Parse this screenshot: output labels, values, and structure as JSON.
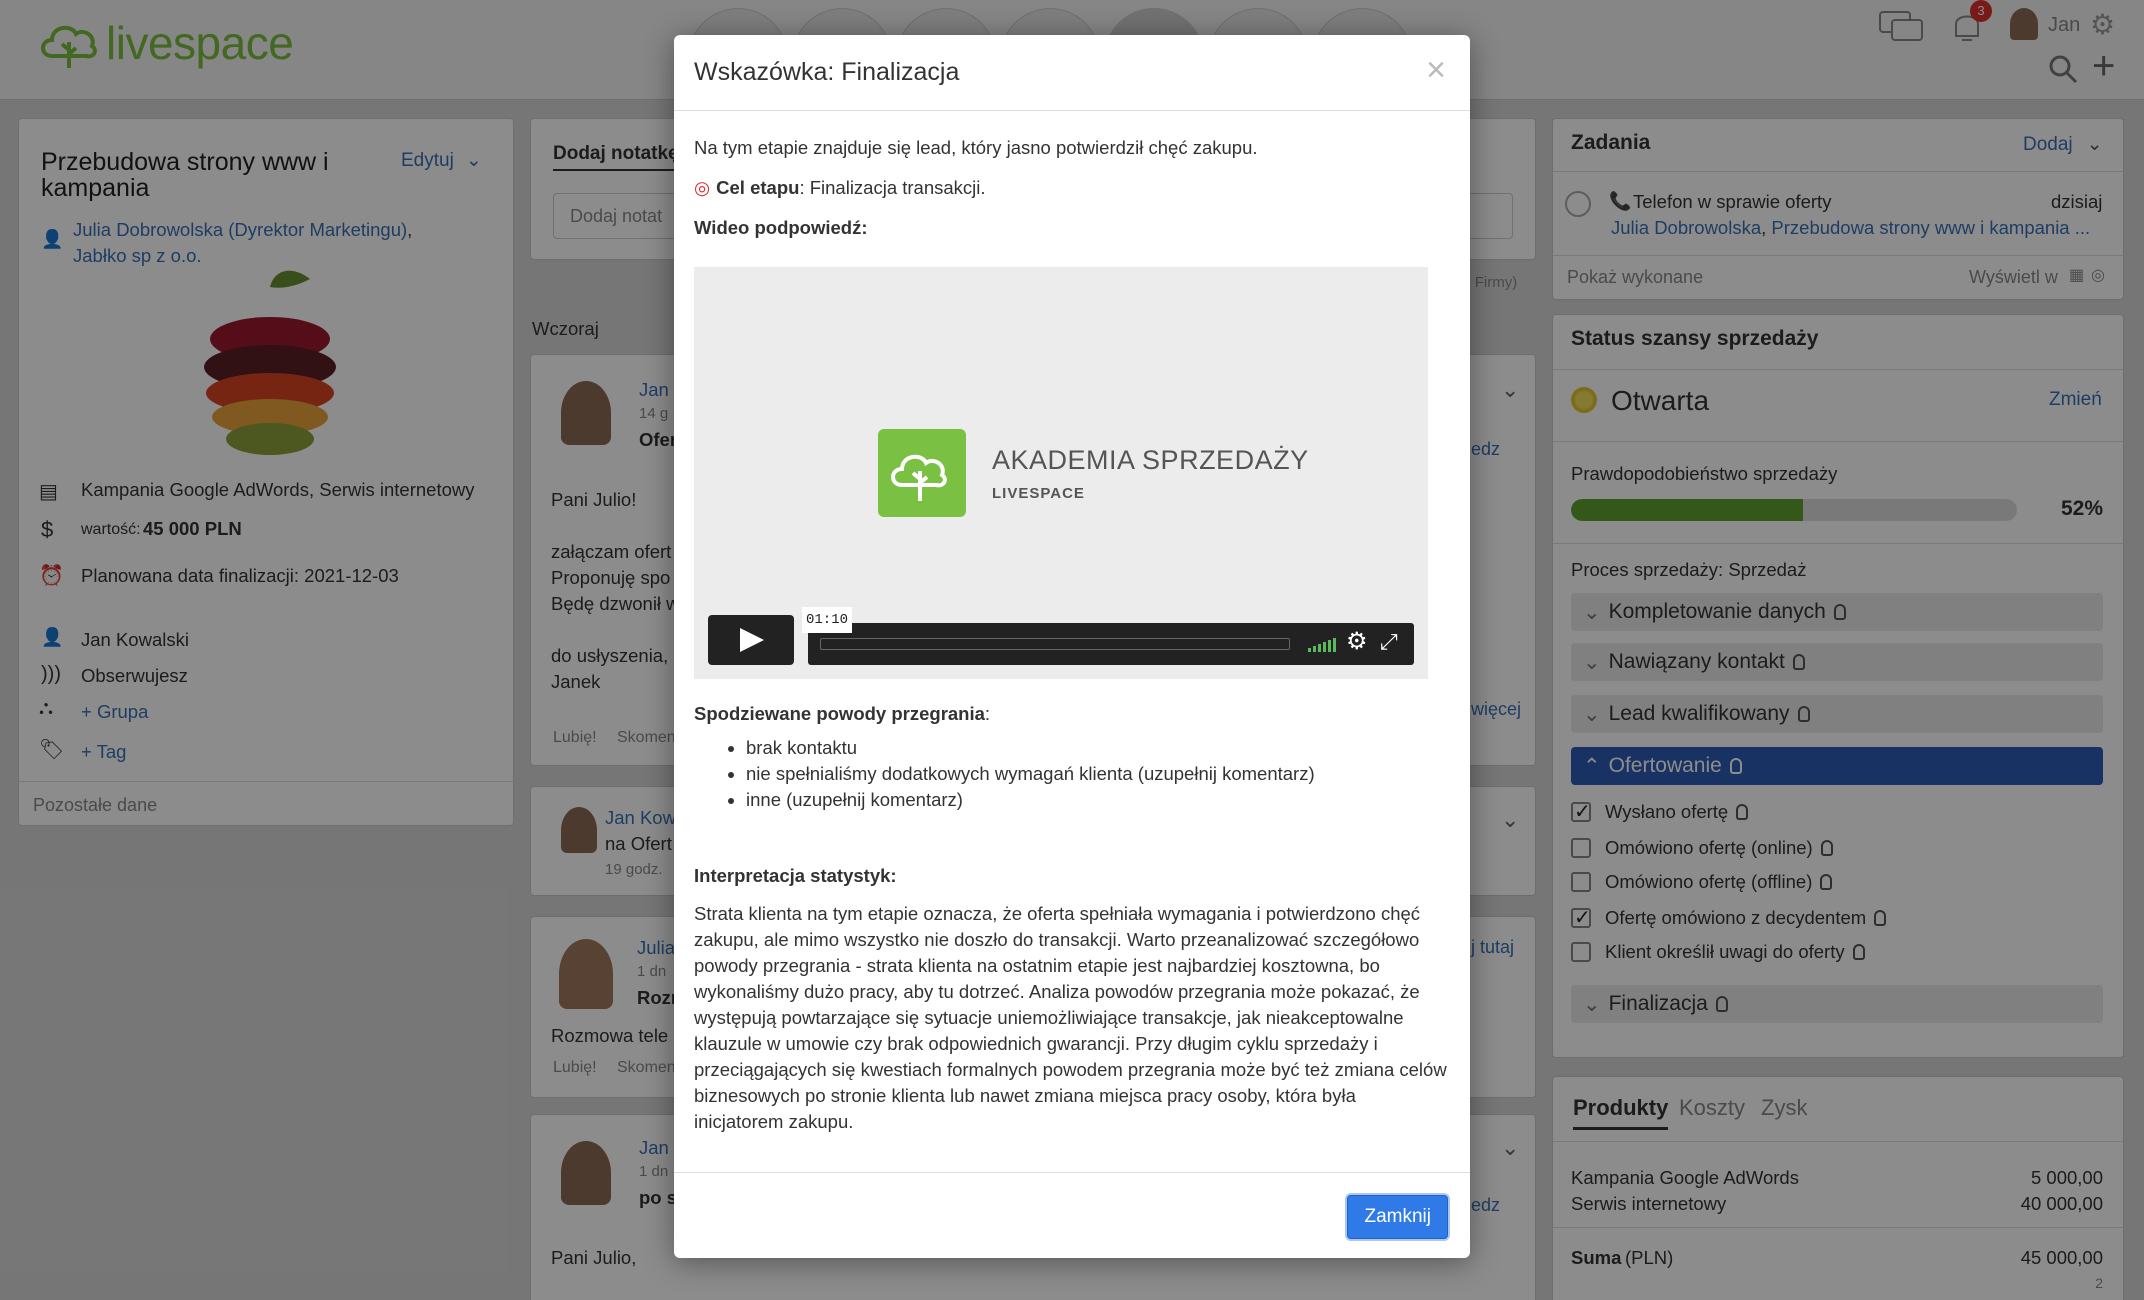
{
  "app": {
    "logo_text": "livespace",
    "user_name": "Jan",
    "notifications_count": "3"
  },
  "deal": {
    "title": "Przebudowa strony www i kampania",
    "edit_label": "Edytuj",
    "contact_link": "Julia Dobrowolska (Dyrektor Marketingu)",
    "company_link": "Jabłko sp z o.o.",
    "products": "Kampania Google AdWords, Serwis internetowy",
    "value_label": "wartość:",
    "value": "45 000 PLN",
    "close_date": "Planowana data finalizacji: 2021-12-03",
    "owner": "Jan Kowalski",
    "follow": "Obserwujesz",
    "group_link": "+ Grupa",
    "tag_link": "+ Tag",
    "other_data": "Pozostałe dane"
  },
  "feed": {
    "tab_add_note": "Dodaj notatkę",
    "note_placeholder": "Dodaj notat",
    "hint": "y, Firmy)",
    "yesterday": "Wczoraj",
    "entry1": {
      "author": "Jan",
      "time": "14 g",
      "subject": "Ofer",
      "body1": "Pani Julio!",
      "body2": "załączam ofert",
      "body3": "Proponuję spo",
      "body4": "Będę dzwonił w",
      "body5": "do usłyszenia,",
      "body6": "Janek",
      "like": "Lubię!",
      "comment": "Skomen",
      "side": "edz",
      "more": "więcej"
    },
    "entry2": {
      "author": "Jan Kow",
      "line": "na Ofert",
      "time": "19 godz."
    },
    "entry3": {
      "author": "Julia",
      "time": "1 dn",
      "subject": "Rozm",
      "body": "Rozmowa tele",
      "like": "Lubię!",
      "comment": "Skomen",
      "side": "j tutaj"
    },
    "entry4": {
      "author": "Jan",
      "time": "1 dn",
      "subject": "po s",
      "body": "Pani Julio,",
      "side": "edz"
    }
  },
  "tasks": {
    "title": "Zadania",
    "add_label": "Dodaj",
    "task_title": "Telefon w sprawie oferty",
    "task_date": "dzisiaj",
    "task_contact": "Julia Dobrowolska",
    "task_deal": "Przebudowa strony www i kampania ...",
    "show_done": "Pokaż wykonane",
    "display_in": "Wyświetl w"
  },
  "status": {
    "title": "Status szansy sprzedaży",
    "state": "Otwarta",
    "change_label": "Zmień",
    "probability_label": "Prawdopodobieństwo sprzedaży",
    "probability": "52%",
    "probability_value": 52,
    "process_label": "Proces sprzedaży: Sprzedaż",
    "stages": [
      "Kompletowanie danych",
      "Nawiązany kontakt",
      "Lead kwalifikowany",
      "Ofertowanie",
      "Finalizacja"
    ],
    "tasks": [
      {
        "label": "Wysłano ofertę",
        "checked": true
      },
      {
        "label": "Omówiono ofertę (online)",
        "checked": false
      },
      {
        "label": "Omówiono ofertę (offline)",
        "checked": false
      },
      {
        "label": "Ofertę omówiono z decydentem",
        "checked": true
      },
      {
        "label": "Klient określił uwagi do oferty",
        "checked": false
      }
    ]
  },
  "products": {
    "tabs": [
      "Produkty",
      "Koszty",
      "Zysk"
    ],
    "items": [
      {
        "name": "Kampania Google AdWords",
        "price": "5 000,00"
      },
      {
        "name": "Serwis internetowy",
        "price": "40 000,00"
      }
    ],
    "sum_label": "Suma",
    "sum_currency": "(PLN)",
    "sum_value": "45 000,00",
    "page": "2"
  },
  "modal": {
    "title": "Wskazówka: Finalizacja",
    "close_symbol": "×",
    "intro": "Na tym etapie znajduje się lead, który jasno potwierdził chęć zakupu.",
    "goal_label": "Cel etapu",
    "goal_text": ": Finalizacja transakcji.",
    "video_label": "Wideo podpowiedź:",
    "video_brand": "AKADEMIA SPRZEDAŻY",
    "video_brand_sub": "LIVESPACE",
    "video_time": "01:10",
    "reasons_label": "Spodziewane powody przegrania",
    "reasons": [
      "brak kontaktu",
      "nie spełnialiśmy dodatkowych wymagań klienta (uzupełnij komentarz)",
      "inne (uzupełnij komentarz)"
    ],
    "stats_label": "Interpretacja statystyk:",
    "stats_text": "Strata klienta na tym etapie oznacza, że oferta spełniała wymagania i potwierdzono chęć zakupu, ale mimo wszystko nie doszło do transakcji. Warto przeanalizować szczegółowo powody przegrania - strata klienta na ostatnim etapie jest najbardziej kosztowna, bo wykonaliśmy dużo pracy, aby tu dotrzeć. Analiza powodów przegrania może pokazać, że występują powtarzające się sytuacje uniemożliwiające transakcje, jak nieakceptowalne klauzule w umowie czy brak odpowiednich gwarancji. Przy długim cyklu sprzedaży i przeciągających się kwestiach formalnych powodem przegrania może być też zmiana celów biznesowych po stronie klienta lub nawet zmiana miejsca pracy osoby, która była inicjatorem zakupu.",
    "close_button": "Zamknij"
  },
  "colors": {
    "accent": "#2f7ae6",
    "brand": "#7bbd3f",
    "active_stage": "#2d5cb5",
    "progress": "#5fa12e"
  }
}
